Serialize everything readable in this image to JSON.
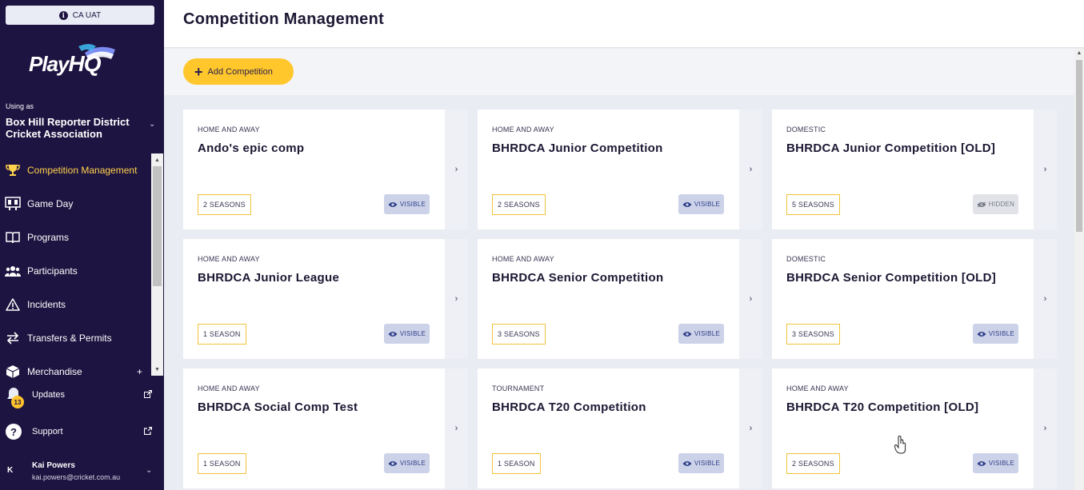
{
  "environment": {
    "label": "CA UAT",
    "icon": "info-icon"
  },
  "brand": {
    "name": "PlayHQ",
    "accent": "#ffc72c",
    "sidebar_bg": "#1e1441"
  },
  "org": {
    "using_as": "Using as",
    "name": "Box Hill Reporter District Cricket Association"
  },
  "nav": [
    {
      "label": "Competition Management",
      "icon": "trophy-icon",
      "active": true
    },
    {
      "label": "Game Day",
      "icon": "scoreboard-icon",
      "active": false
    },
    {
      "label": "Programs",
      "icon": "book-icon",
      "active": false
    },
    {
      "label": "Participants",
      "icon": "people-icon",
      "active": false
    },
    {
      "label": "Incidents",
      "icon": "warning-icon",
      "active": false
    },
    {
      "label": "Transfers & Permits",
      "icon": "transfer-icon",
      "active": false
    },
    {
      "label": "Merchandise",
      "icon": "box-icon",
      "active": false,
      "expand": "+"
    }
  ],
  "footer": {
    "updates": {
      "label": "Updates",
      "badge": "13"
    },
    "support": {
      "label": "Support"
    },
    "user": {
      "initial": "K",
      "name": "Kai Powers",
      "email": "kai.powers@cricket.com.au"
    }
  },
  "header": {
    "title": "Competition Management"
  },
  "toolbar": {
    "add_label": "Add Competition"
  },
  "competitions": [
    {
      "type": "HOME AND AWAY",
      "name": "Ando's epic comp",
      "seasons": "2 SEASONS",
      "status": "VISIBLE"
    },
    {
      "type": "HOME AND AWAY",
      "name": "BHRDCA Junior Competition",
      "seasons": "2 SEASONS",
      "status": "VISIBLE"
    },
    {
      "type": "DOMESTIC",
      "name": "BHRDCA Junior Competition [OLD]",
      "seasons": "5 SEASONS",
      "status": "HIDDEN"
    },
    {
      "type": "HOME AND AWAY",
      "name": "BHRDCA Junior League",
      "seasons": "1 SEASON",
      "status": "VISIBLE"
    },
    {
      "type": "HOME AND AWAY",
      "name": "BHRDCA Senior Competition",
      "seasons": "3 SEASONS",
      "status": "VISIBLE"
    },
    {
      "type": "DOMESTIC",
      "name": "BHRDCA Senior Competition [OLD]",
      "seasons": "3 SEASONS",
      "status": "VISIBLE"
    },
    {
      "type": "HOME AND AWAY",
      "name": "BHRDCA Social Comp Test",
      "seasons": "1 SEASON",
      "status": "VISIBLE"
    },
    {
      "type": "TOURNAMENT",
      "name": "BHRDCA T20 Competition",
      "seasons": "1 SEASON",
      "status": "VISIBLE"
    },
    {
      "type": "HOME AND AWAY",
      "name": "BHRDCA T20 Competition [OLD]",
      "seasons": "2 SEASONS",
      "status": "VISIBLE"
    }
  ]
}
